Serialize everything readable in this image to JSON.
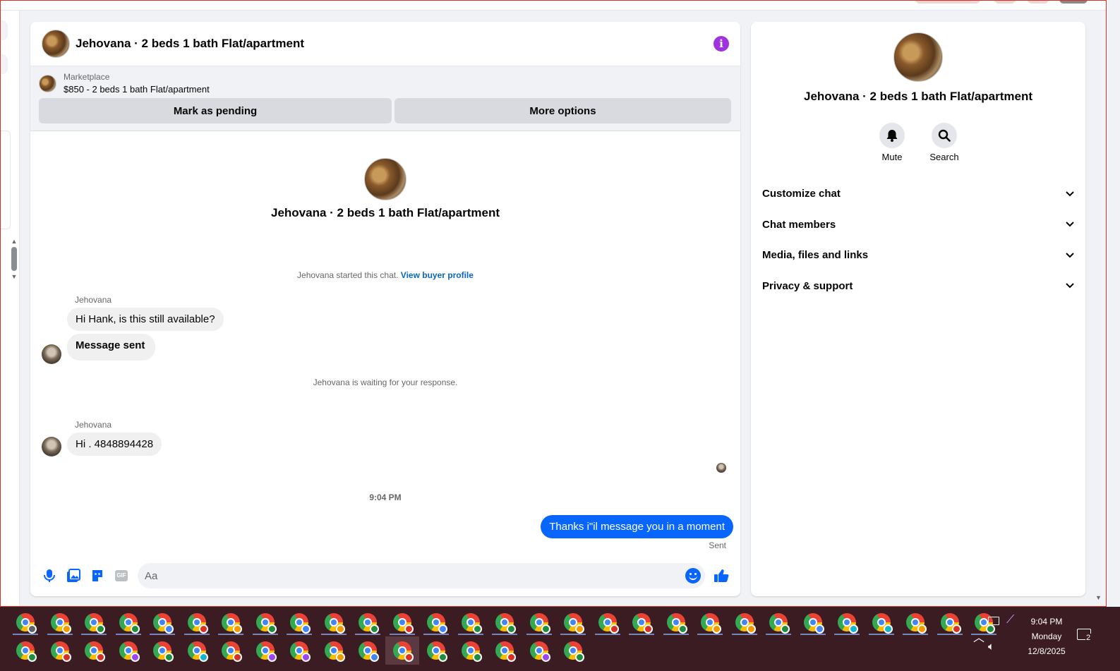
{
  "chat": {
    "title": "Jehovana · 2 beds 1 bath Flat/apartment",
    "listing": {
      "kicker": "Marketplace",
      "price_line": "$850 - 2 beds 1 bath Flat/apartment",
      "mark_pending_label": "Mark as pending",
      "more_options_label": "More options"
    },
    "hero_name": "Jehovana · 2 beds 1 bath Flat/apartment",
    "started_note": "Jehovana started this chat.",
    "view_profile_link": "View buyer profile",
    "waiting_note": "Jehovana is waiting for your response.",
    "messages": [
      {
        "sender": "Jehovana",
        "text": "Hi Hank, is this still available?"
      },
      {
        "text": "Message sent"
      },
      {
        "sender": "Jehovana",
        "text": "Hi . 4848894428"
      },
      {
        "text": "Thanks i\"il message you in a moment",
        "status": "Sent"
      }
    ],
    "time_separator": "9:04 PM",
    "composer": {
      "placeholder": "Aa",
      "icons": [
        "microphone-icon",
        "photo-icon",
        "sticker-icon",
        "gif-icon",
        "emoji-icon",
        "thumbs-up-icon"
      ],
      "gif_label": "GIF"
    }
  },
  "info_panel": {
    "name": "Jehovana · 2 beds 1 bath Flat/apartment",
    "actions": [
      {
        "label": "Mute",
        "icon": "bell-icon"
      },
      {
        "label": "Search",
        "icon": "search-icon"
      }
    ],
    "sections": [
      "Customize chat",
      "Chat members",
      "Media, files and links",
      "Privacy & support"
    ]
  },
  "colors": {
    "accent_blue": "#0866ff",
    "info_purple": "#a033e0",
    "taskbar": "#3a1c22"
  },
  "taskbar": {
    "app_icon": "chrome-profile-icon",
    "row1_badges": [
      "#5f6368",
      "#f29900",
      "#1e8e3e",
      "#1e8e3e",
      "#4285f4",
      "#d93025",
      "#f29900",
      "#1e8e3e",
      "#4285f4",
      "#f29900",
      "#1e8e3e",
      "#d93025",
      "#4285f4",
      "#1e8e3e",
      "#1e8e3e",
      "#1e8e3e",
      "#f29900",
      "#d93025",
      "#d93025",
      "#1e8e3e",
      "#f29900",
      "#f29900",
      "#1e8e3e",
      "#4285f4",
      "#12b5cb",
      "#12b5cb",
      "#f29900",
      "#d93025",
      "#1e8e3e"
    ],
    "row2_badges": [
      "#1e8e3e",
      "#d93025",
      "#d93025",
      "#a142f4",
      "#1e8e3e",
      "#12b5cb",
      "#d93025",
      "#a142f4",
      "#a142f4",
      "#f29900",
      "#4285f4",
      "#d93025",
      "#1e8e3e",
      "#1e8e3e",
      "#d93025",
      "#a142f4",
      "#1e8e3e"
    ],
    "row2_active_index": 11,
    "tray": {
      "time": "9:04 PM",
      "day": "Monday",
      "date": "12/8/2025",
      "notification_count": "2"
    }
  }
}
